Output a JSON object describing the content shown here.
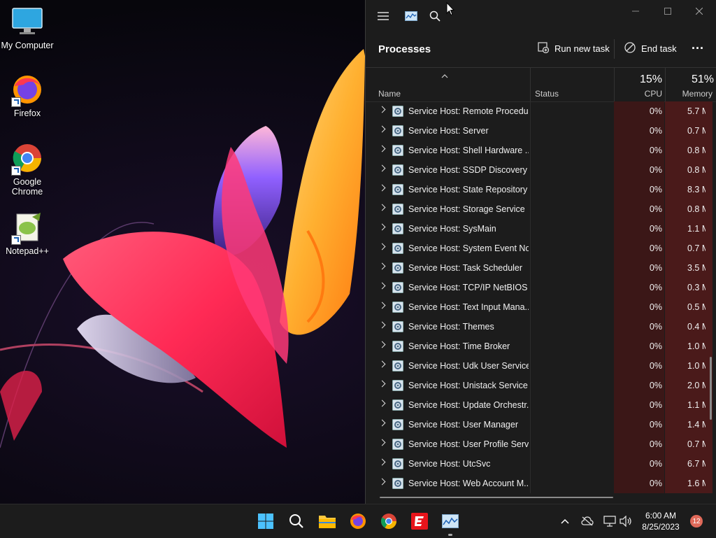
{
  "desktop": {
    "icons": [
      {
        "label": "My Computer",
        "icon": "monitor-icon"
      },
      {
        "label": "Firefox",
        "icon": "firefox-icon"
      },
      {
        "label": "Google Chrome",
        "icon": "chrome-icon"
      },
      {
        "label": "Notepad++",
        "icon": "notepad-plus-plus-icon"
      }
    ]
  },
  "task_manager": {
    "page_title": "Processes",
    "toolbar": {
      "run_new_task": "Run new task",
      "end_task": "End task",
      "more": "..."
    },
    "columns": {
      "name": "Name",
      "status": "Status",
      "cpu_pct": "15%",
      "cpu": "CPU",
      "memory_pct": "51%",
      "memory": "Memory"
    },
    "rows": [
      {
        "name": "Service Host: Remote Procedu...",
        "cpu": "0%",
        "memory": "5.7 M"
      },
      {
        "name": "Service Host: Server",
        "cpu": "0%",
        "memory": "0.7 M"
      },
      {
        "name": "Service Host: Shell Hardware ...",
        "cpu": "0%",
        "memory": "0.8 M"
      },
      {
        "name": "Service Host: SSDP Discovery",
        "cpu": "0%",
        "memory": "0.8 M"
      },
      {
        "name": "Service Host: State Repository ...",
        "cpu": "0%",
        "memory": "8.3 M"
      },
      {
        "name": "Service Host: Storage Service",
        "cpu": "0%",
        "memory": "0.8 M"
      },
      {
        "name": "Service Host: SysMain",
        "cpu": "0%",
        "memory": "1.1 M"
      },
      {
        "name": "Service Host: System Event No...",
        "cpu": "0%",
        "memory": "0.7 M"
      },
      {
        "name": "Service Host: Task Scheduler",
        "cpu": "0%",
        "memory": "3.5 M"
      },
      {
        "name": "Service Host: TCP/IP NetBIOS ...",
        "cpu": "0%",
        "memory": "0.3 M"
      },
      {
        "name": "Service Host: Text Input Mana...",
        "cpu": "0%",
        "memory": "0.5 M"
      },
      {
        "name": "Service Host: Themes",
        "cpu": "0%",
        "memory": "0.4 M"
      },
      {
        "name": "Service Host: Time Broker",
        "cpu": "0%",
        "memory": "1.0 M"
      },
      {
        "name": "Service Host: Udk User Service...",
        "cpu": "0%",
        "memory": "1.0 M"
      },
      {
        "name": "Service Host: Unistack Service ...",
        "cpu": "0%",
        "memory": "2.0 M"
      },
      {
        "name": "Service Host: Update Orchestr...",
        "cpu": "0%",
        "memory": "1.1 M"
      },
      {
        "name": "Service Host: User Manager",
        "cpu": "0%",
        "memory": "1.4 M"
      },
      {
        "name": "Service Host: User Profile Servi...",
        "cpu": "0%",
        "memory": "0.7 M"
      },
      {
        "name": "Service Host: UtcSvc",
        "cpu": "0%",
        "memory": "6.7 M"
      },
      {
        "name": "Service Host: Web Account M...",
        "cpu": "0%",
        "memory": "1.6 M"
      }
    ]
  },
  "taskbar": {
    "apps": [
      "start-icon",
      "search-icon",
      "file-explorer-icon",
      "firefox-icon",
      "chrome-icon",
      "red-app-icon",
      "task-manager-icon"
    ],
    "clock_time": "6:00 AM",
    "clock_date": "8/25/2023",
    "notification_count": "12"
  },
  "colors": {
    "window_bg": "#1c1c1c",
    "cpu_heat": "#3b1717",
    "memory_heat": "#4a1a1a",
    "taskbar_bg": "#1c1c1c"
  }
}
